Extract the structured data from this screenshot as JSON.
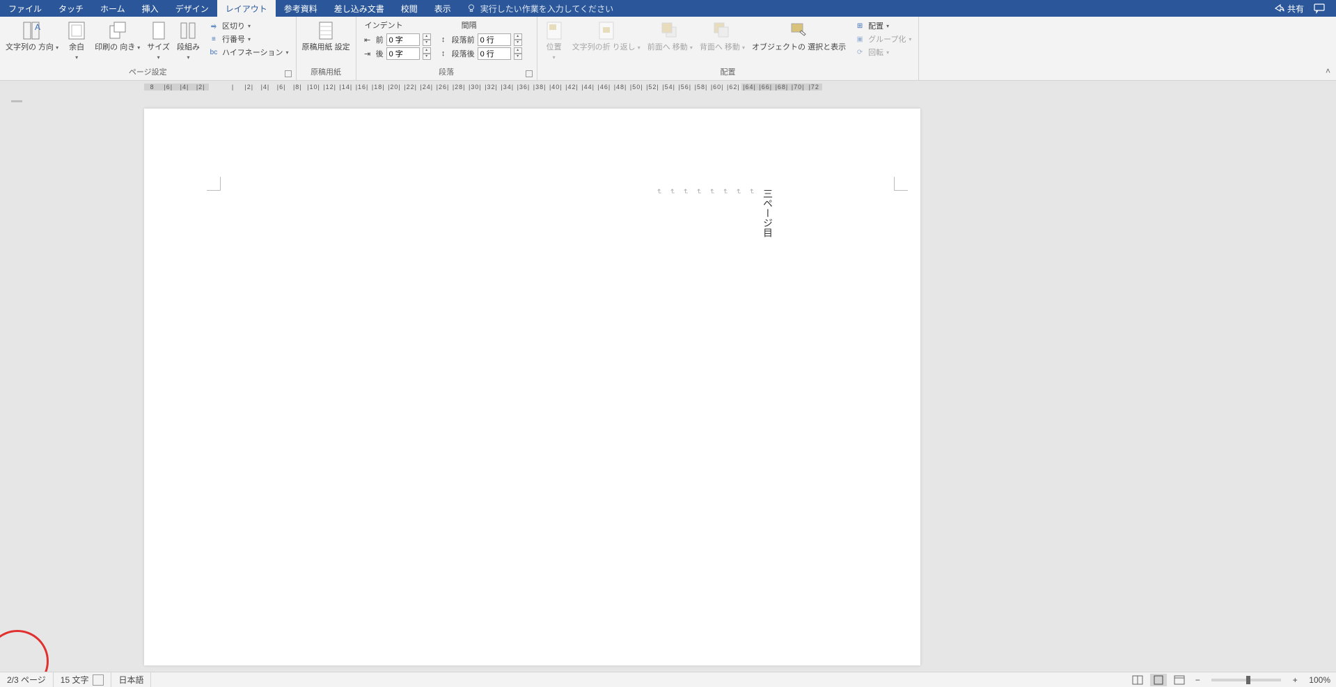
{
  "tabs": {
    "file": "ファイル",
    "touch": "タッチ",
    "home": "ホーム",
    "insert": "挿入",
    "design": "デザイン",
    "layout": "レイアウト",
    "reference": "参考資料",
    "mailings": "差し込み文書",
    "review": "校閲",
    "view": "表示",
    "tellme_placeholder": "実行したい作業を入力してください",
    "share": "共有"
  },
  "ribbon": {
    "page_setup": {
      "text_dir": "文字列の\n方向",
      "margins": "余白",
      "orientation": "印刷の\n向き",
      "size": "サイズ",
      "columns": "段組み",
      "breaks": "区切り",
      "line_numbers": "行番号",
      "hyphenation": "ハイフネーション",
      "label": "ページ設定"
    },
    "manuscript": {
      "settings": "原稿用紙\n設定",
      "label": "原稿用紙"
    },
    "paragraph": {
      "indent_header": "インデント",
      "spacing_header": "間隔",
      "left_label": "前",
      "right_label": "後",
      "before_label": "段落前",
      "after_label": "段落後",
      "left_val": "0 字",
      "right_val": "0 字",
      "before_val": "0 行",
      "after_val": "0 行",
      "label": "段落"
    },
    "arrange": {
      "position": "位置",
      "wrap": "文字列の折\nり返し",
      "bring_forward": "前面へ\n移動",
      "send_backward": "背面へ\n移動",
      "selection_pane": "オブジェクトの\n選択と表示",
      "align": "配置",
      "group": "グループ化",
      "rotate": "回転",
      "label": "配置"
    }
  },
  "ruler_ticks": [
    "8",
    "|6|",
    "|4|",
    "|2|",
    "",
    "|",
    "|2|",
    "|4|",
    "|6|",
    "|8|",
    "|10|",
    "|12|",
    "|14|",
    "|16|",
    "|18|",
    "|20|",
    "|22|",
    "|24|",
    "|26|",
    "|28|",
    "|30|",
    "|32|",
    "|34|",
    "|36|",
    "|38|",
    "|40|",
    "|42|",
    "|44|",
    "|46|",
    "|48|",
    "|50|",
    "|52|",
    "|54|",
    "|56|",
    "|58|",
    "|60|",
    "|62|",
    "|64|",
    "|66|",
    "|68|",
    "|70|",
    "|72"
  ],
  "document": {
    "page_text": "三ページ目"
  },
  "status": {
    "page": "2/3 ページ",
    "words": "15 文字",
    "lang": "日本語",
    "zoom": "100%"
  }
}
